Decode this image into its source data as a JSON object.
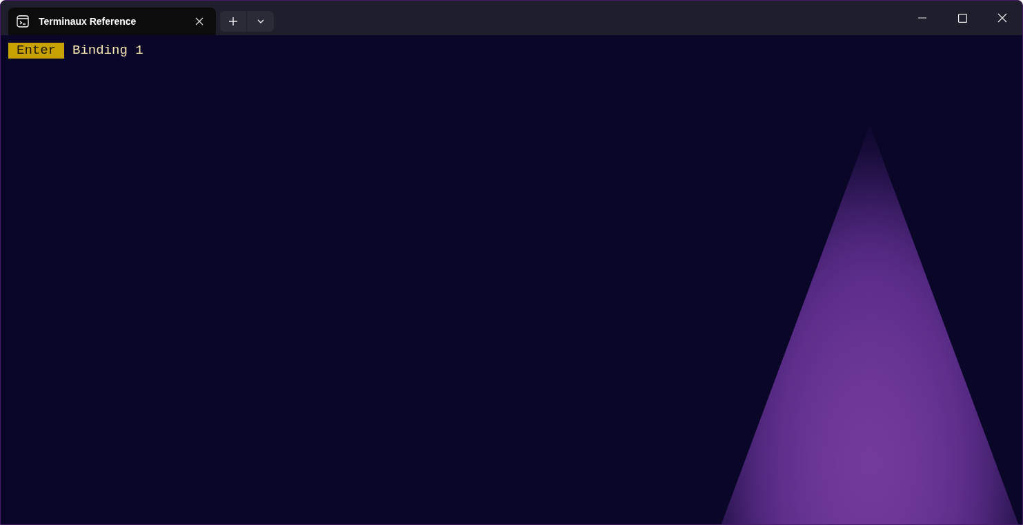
{
  "tabs": [
    {
      "title": "Terminaux Reference",
      "selected": true
    }
  ],
  "terminal": {
    "bindings": [
      {
        "key": "Enter",
        "label": "Binding 1"
      }
    ]
  }
}
